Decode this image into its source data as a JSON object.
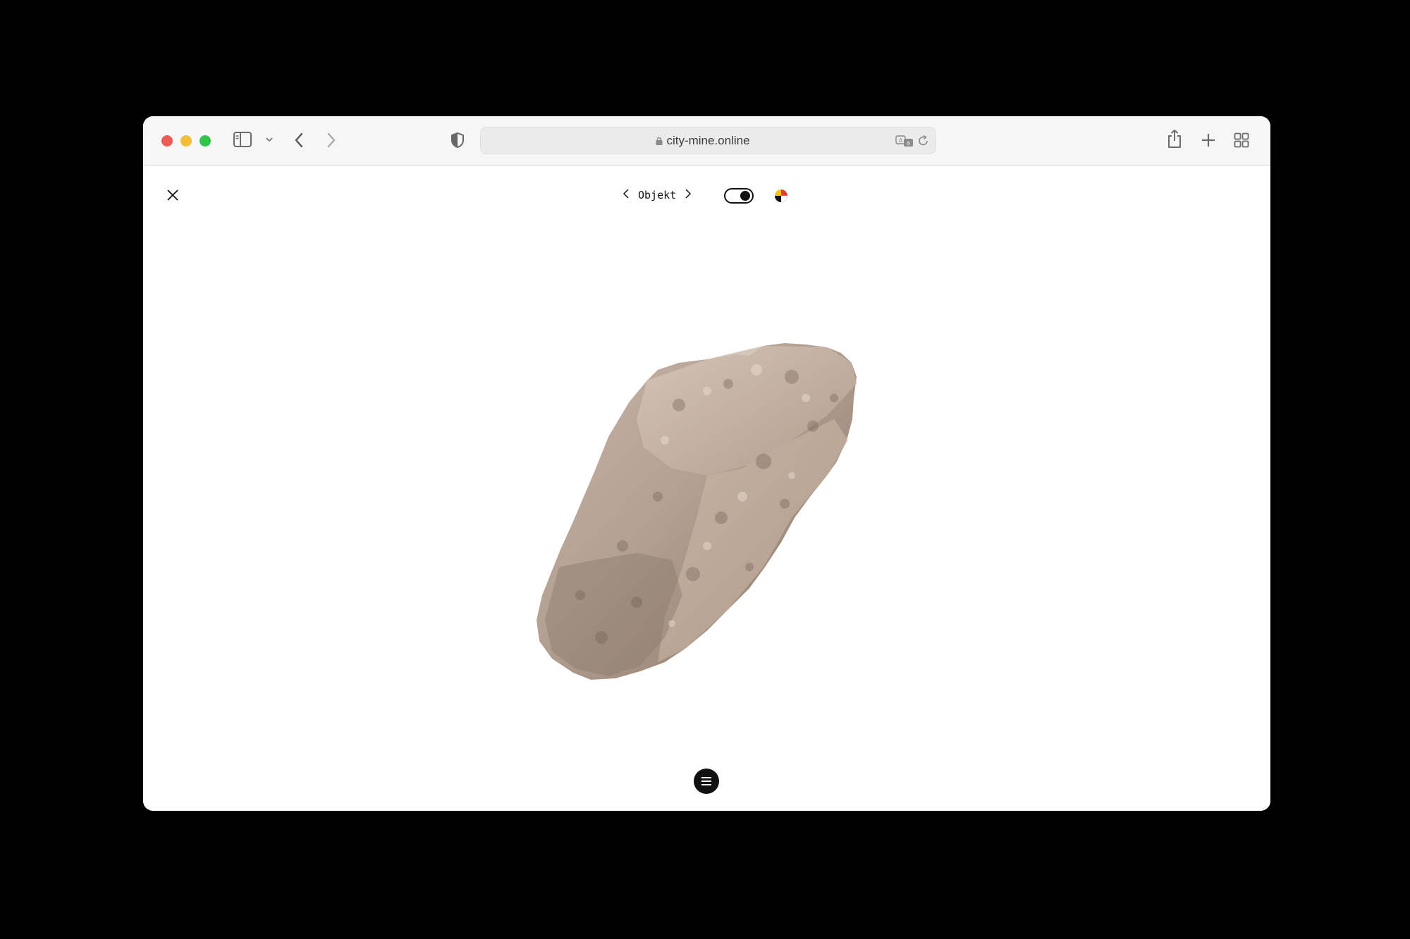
{
  "browser": {
    "url": "city-mine.online",
    "traffic_colors": {
      "close": "#ee5b55",
      "minimize": "#f4bd36",
      "zoom": "#2ec549"
    },
    "icons": [
      "sidebar-icon",
      "chevron-down-icon",
      "back-arrow-icon",
      "forward-arrow-icon",
      "privacy-shield-icon",
      "lock-icon",
      "translate-icon",
      "reload-icon",
      "share-icon",
      "new-tab-plus-icon",
      "tab-overview-icon"
    ]
  },
  "page": {
    "nav_label": "Objekt",
    "theme_toggle": "on",
    "icons": [
      "close-icon",
      "prev-chevron-icon",
      "next-chevron-icon",
      "color-palette-icon",
      "menu-icon"
    ],
    "object": "rock-3d-model"
  }
}
